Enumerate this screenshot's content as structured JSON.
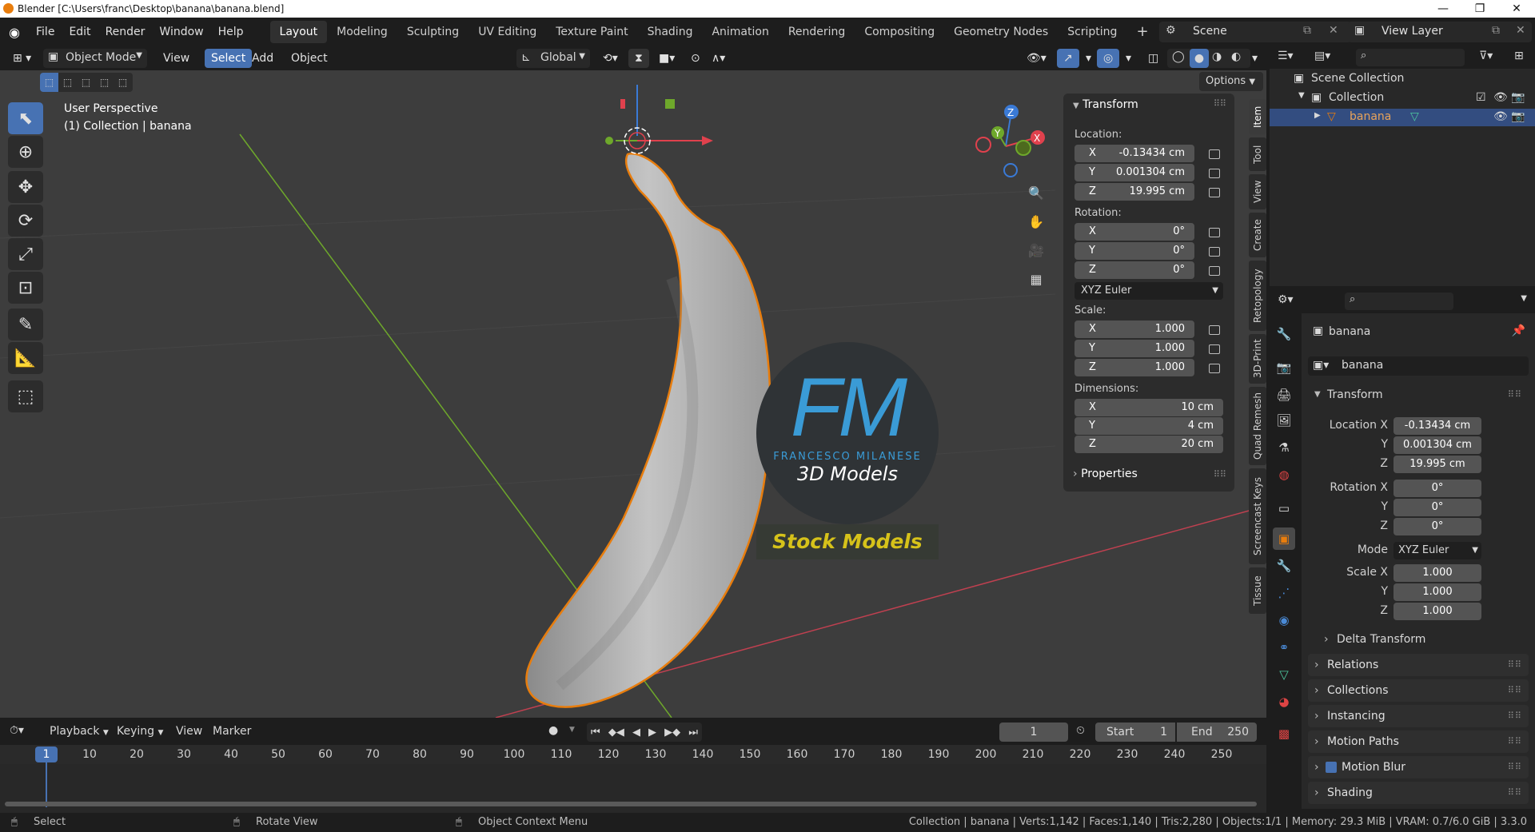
{
  "window": {
    "title": "Blender [C:\\Users\\franc\\Desktop\\banana\\banana.blend]",
    "minimize": "—",
    "maximize": "❐",
    "close": "✕"
  },
  "menu": [
    "File",
    "Edit",
    "Render",
    "Window",
    "Help"
  ],
  "workspaces": [
    "Layout",
    "Modeling",
    "Sculpting",
    "UV Editing",
    "Texture Paint",
    "Shading",
    "Animation",
    "Rendering",
    "Compositing",
    "Geometry Nodes",
    "Scripting"
  ],
  "active_workspace": "Layout",
  "add_workspace": "+",
  "scene": {
    "name": "Scene",
    "view_layer": "View Layer"
  },
  "viewport_header": {
    "mode": "Object Mode",
    "view": "View",
    "select": "Select",
    "add": "Add",
    "object": "Object",
    "orientation": "Global",
    "options": "Options"
  },
  "viewport": {
    "perspective": "User Perspective",
    "collection": "(1) Collection | banana"
  },
  "watermark": {
    "initials": "FM",
    "name": "FRANCESCO MILANESE",
    "sub": "3D Models",
    "stock": "Stock Models"
  },
  "npanel": {
    "header": "Transform",
    "location_label": "Location:",
    "location": [
      {
        "ax": "X",
        "v": "-0.13434 cm"
      },
      {
        "ax": "Y",
        "v": "0.001304 cm"
      },
      {
        "ax": "Z",
        "v": "19.995 cm"
      }
    ],
    "rotation_label": "Rotation:",
    "rotation": [
      {
        "ax": "X",
        "v": "0°"
      },
      {
        "ax": "Y",
        "v": "0°"
      },
      {
        "ax": "Z",
        "v": "0°"
      }
    ],
    "rotation_mode": "XYZ Euler",
    "scale_label": "Scale:",
    "scale": [
      {
        "ax": "X",
        "v": "1.000"
      },
      {
        "ax": "Y",
        "v": "1.000"
      },
      {
        "ax": "Z",
        "v": "1.000"
      }
    ],
    "dimensions_label": "Dimensions:",
    "dimensions": [
      {
        "ax": "X",
        "v": "10 cm"
      },
      {
        "ax": "Y",
        "v": "4 cm"
      },
      {
        "ax": "Z",
        "v": "20 cm"
      }
    ],
    "properties": "Properties"
  },
  "side_tabs": [
    "Item",
    "Tool",
    "View",
    "Create",
    "Retopology",
    "3D-Print",
    "Quad Remesh",
    "Screencast Keys",
    "Tissue"
  ],
  "outliner": {
    "scene_collection": "Scene Collection",
    "collection": "Collection",
    "object": "banana"
  },
  "properties": {
    "object_name": "banana",
    "data_name": "banana",
    "transform": "Transform",
    "location_x_label": "Location X",
    "y_label": "Y",
    "z_label": "Z",
    "location": [
      "-0.13434 cm",
      "0.001304 cm",
      "19.995 cm"
    ],
    "rotation_x_label": "Rotation X",
    "rotation": [
      "0°",
      "0°",
      "0°"
    ],
    "mode_label": "Mode",
    "mode": "XYZ Euler",
    "scale_x_label": "Scale X",
    "scale": [
      "1.000",
      "1.000",
      "1.000"
    ],
    "delta": "Delta Transform",
    "sections": [
      "Relations",
      "Collections",
      "Instancing",
      "Motion Paths",
      "Motion Blur",
      "Shading"
    ]
  },
  "timeline": {
    "menus": [
      "Playback",
      "Keying",
      "View",
      "Marker"
    ],
    "current_frame": "1",
    "start_label": "Start",
    "start": "1",
    "end_label": "End",
    "end": "250",
    "ticks": [
      "1",
      "10",
      "20",
      "30",
      "40",
      "50",
      "60",
      "70",
      "80",
      "90",
      "100",
      "110",
      "120",
      "130",
      "140",
      "150",
      "160",
      "170",
      "180",
      "190",
      "200",
      "210",
      "220",
      "230",
      "240",
      "250"
    ]
  },
  "status": {
    "select": "Select",
    "rotate": "Rotate View",
    "context": "Object Context Menu",
    "stats": "Collection | banana | Verts:1,142 | Faces:1,140 | Tris:2,280 | Objects:1/1 | Memory: 29.3 MiB | VRAM: 0.7/6.0 GiB | 3.3.0"
  },
  "colors": {
    "accent": "#4772b3",
    "selection": "#e87d0d",
    "x_axis": "#e0414d",
    "y_axis": "#6ea82b",
    "z_axis": "#3a7ad6",
    "stock": "#d6c21a"
  }
}
